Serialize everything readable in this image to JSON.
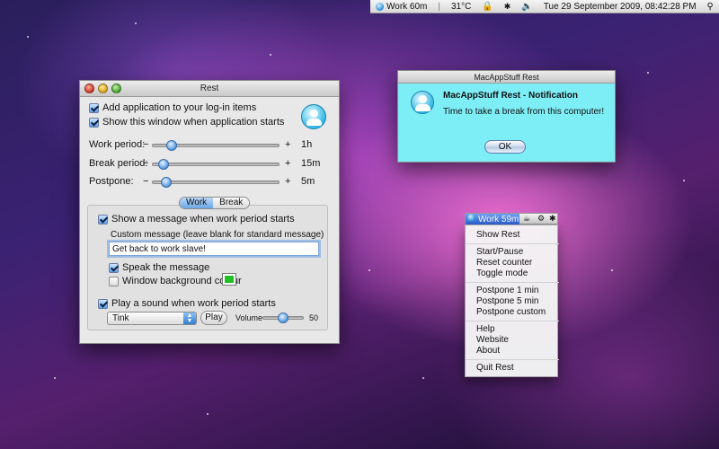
{
  "menubar": {
    "work_label": "Work 60m",
    "temperature": "31°C",
    "datetime": "Tue 29 September 2009, 08:42:28 PM",
    "icons": [
      "rest-status-icon",
      "lock-icon",
      "bluetooth-icon",
      "volume-icon",
      "spotlight-icon"
    ]
  },
  "rest_window": {
    "title": "Rest",
    "add_login": "Add application to your log-in items",
    "show_window": "Show this window when application starts",
    "sliders": [
      {
        "label": "Work period:",
        "value": "1h",
        "level": 0.12
      },
      {
        "label": "Break period:",
        "value": "15m",
        "level": 0.05
      },
      {
        "label": "Postpone:",
        "value": "5m",
        "level": 0.07
      }
    ],
    "minus": "−",
    "plus": "+",
    "tabs": [
      "Work",
      "Break"
    ],
    "show_message": "Show a message when work period starts",
    "custom_message_label": "Custom message (leave blank for standard message)",
    "custom_message_value": "Get back to work slave!",
    "speak": "Speak the message",
    "bg_colour": "Window background colour",
    "bg_colour_value": "#22c020",
    "play_sound": "Play a sound when work period starts",
    "sound": "Tink",
    "play_button": "Play",
    "volume_label": "Volume",
    "volume_value": "50",
    "volume_level": 0.5
  },
  "notification": {
    "title": "MacAppStuff Rest",
    "heading": "MacAppStuff Rest - Notification",
    "message": "Time to take a break from this computer!",
    "ok": "OK",
    "bg_color": "#7eeef6"
  },
  "status_menu": {
    "work_label": "Work 59m",
    "items_group1": [
      "Show Rest"
    ],
    "items_group2": [
      "Start/Pause",
      "Reset counter",
      "Toggle mode"
    ],
    "items_group3": [
      "Postpone 1 min",
      "Postpone 5 min",
      "Postpone custom"
    ],
    "items_group4": [
      "Help",
      "Website",
      "About"
    ],
    "items_group5": [
      "Quit Rest"
    ]
  }
}
